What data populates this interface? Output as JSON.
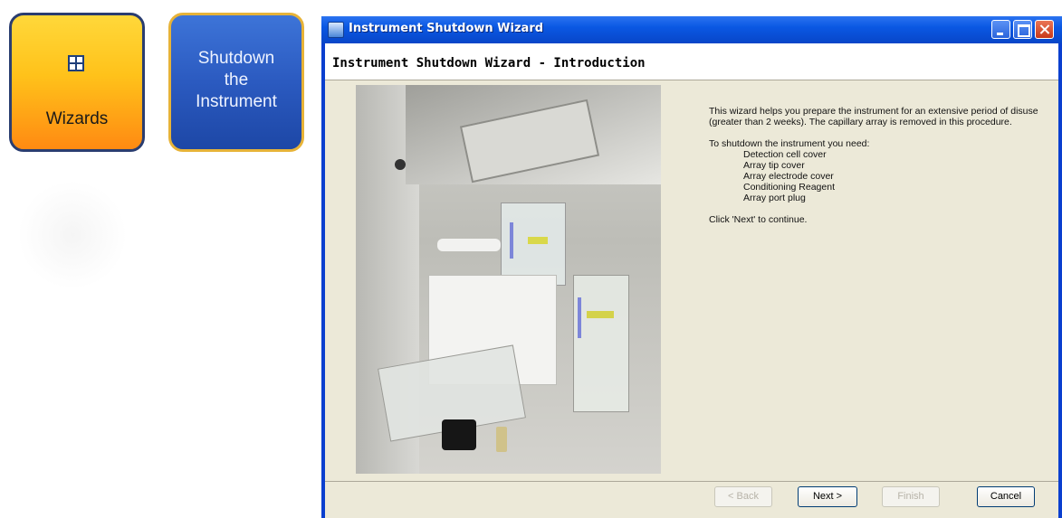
{
  "tiles": {
    "wizards_label": "Wizards",
    "shutdown_label": "Shutdown\nthe\nInstrument"
  },
  "window": {
    "title": "Instrument Shutdown Wizard",
    "header": "Instrument Shutdown Wizard - Introduction"
  },
  "intro": {
    "p1": "This wizard helps you prepare the instrument for an extensive period of disuse (greater than 2 weeks).  The capillary array is removed in this procedure.",
    "needs_heading": "To shutdown the instrument you need:",
    "needs": [
      "Detection cell cover",
      "Array tip cover",
      "Array electrode cover",
      "Conditioning Reagent",
      "Array port plug"
    ],
    "continue": "Click 'Next' to continue."
  },
  "buttons": {
    "back": "< Back",
    "next": "Next >",
    "finish": "Finish",
    "cancel": "Cancel"
  },
  "colors": {
    "wizards_tile": "#ffc21a",
    "shutdown_tile": "#2b5ac0",
    "title_bar": "#0a58e3",
    "window_face": "#ece9d8"
  }
}
